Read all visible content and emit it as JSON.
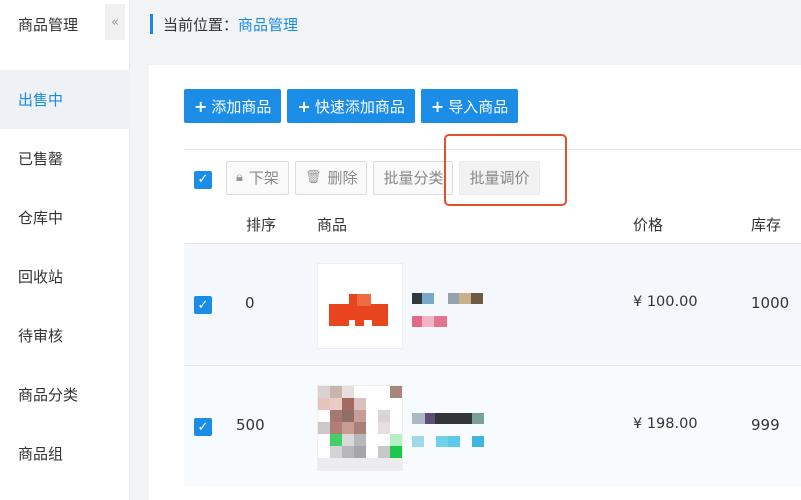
{
  "sidebar": {
    "title": "商品管理",
    "collapse_glyph": "«",
    "items": [
      {
        "label": "出售中",
        "active": true
      },
      {
        "label": "已售罄"
      },
      {
        "label": "仓库中"
      },
      {
        "label": "回收站"
      },
      {
        "label": "待审核"
      },
      {
        "label": "商品分类"
      },
      {
        "label": "商品组"
      }
    ]
  },
  "breadcrumb": {
    "prefix": "当前位置：",
    "current": "商品管理"
  },
  "actions": {
    "add": "添加商品",
    "quick_add": "快速添加商品",
    "import": "导入商品"
  },
  "toolbar": {
    "offline": "下架",
    "delete": "删除",
    "batch_category": "批量分类",
    "batch_price": "批量调价"
  },
  "table": {
    "headers": {
      "sort": "排序",
      "product": "商品",
      "price": "价格",
      "stock": "库存"
    },
    "rows": [
      {
        "sort": "0",
        "price": "¥ 100.00",
        "stock": "1000",
        "checked": true
      },
      {
        "sort": "500",
        "price": "¥ 198.00",
        "stock": "999",
        "checked": true
      }
    ]
  },
  "colors": {
    "accent": "#1c8de7",
    "highlight_box": "#e2512b",
    "active_nav_bg": "#eef1f6"
  }
}
